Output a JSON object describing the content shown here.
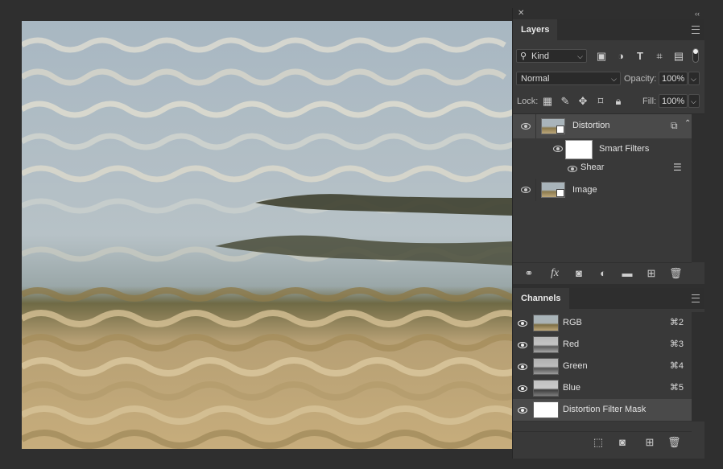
{
  "canvas": {
    "description_icon": "image-canvas"
  },
  "panel": {
    "close_glyph": "✕",
    "collapse_glyph": "‹‹"
  },
  "layers": {
    "tab_label": "Layers",
    "filter_kind": "Kind",
    "blend_mode": "Normal",
    "opacity_label": "Opacity:",
    "opacity_value": "100%",
    "lock_label": "Lock:",
    "fill_label": "Fill:",
    "fill_value": "100%",
    "items": [
      {
        "name": "Distortion",
        "selected": true
      },
      {
        "name": "Smart Filters"
      },
      {
        "name": "Shear"
      },
      {
        "name": "Image"
      }
    ],
    "bottom_icons": [
      "link-icon",
      "fx-icon",
      "mask-icon",
      "adjustment-icon",
      "folder-icon",
      "new-layer-icon",
      "trash-icon"
    ],
    "fx_text": "fx"
  },
  "channels": {
    "tab_label": "Channels",
    "rows": [
      {
        "name": "RGB",
        "shortcut": "⌘2"
      },
      {
        "name": "Red",
        "shortcut": "⌘3"
      },
      {
        "name": "Green",
        "shortcut": "⌘4"
      },
      {
        "name": "Blue",
        "shortcut": "⌘5"
      },
      {
        "name": "Distortion Filter Mask",
        "shortcut": ""
      }
    ],
    "bottom_icons": [
      "selection-icon",
      "save-mask-icon",
      "new-channel-icon",
      "trash-icon"
    ]
  },
  "colors": {
    "panel_bg": "#393939",
    "selected_row": "#4a4a4a",
    "app_bg": "#2f2f2f"
  }
}
